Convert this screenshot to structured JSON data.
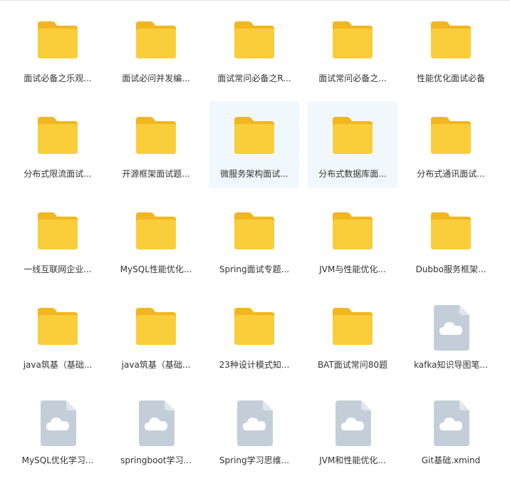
{
  "colors": {
    "folder_back": "#f2b61f",
    "folder_front": "#f9ce3a",
    "file_body": "#c4ced8",
    "file_fold": "#dfe6ec",
    "cloud": "#ffffff",
    "hover_bg": "#f1f8fd"
  },
  "items": [
    {
      "label": "面试必备之乐观...",
      "type": "folder-icon",
      "highlighted": false
    },
    {
      "label": "面试必问并发编...",
      "type": "folder-icon",
      "highlighted": false
    },
    {
      "label": "面试常问必备之R...",
      "type": "folder-icon",
      "highlighted": false
    },
    {
      "label": "面试常问必备之...",
      "type": "folder-icon",
      "highlighted": false
    },
    {
      "label": "性能优化面试必备",
      "type": "folder-icon",
      "highlighted": false
    },
    {
      "label": "分布式限流面试...",
      "type": "folder-icon",
      "highlighted": false
    },
    {
      "label": "开源框架面试题...",
      "type": "folder-icon",
      "highlighted": false
    },
    {
      "label": "微服务架构面试...",
      "type": "folder-icon",
      "highlighted": true
    },
    {
      "label": "分布式数据库面...",
      "type": "folder-icon",
      "highlighted": true
    },
    {
      "label": "分布式通讯面试...",
      "type": "folder-icon",
      "highlighted": false
    },
    {
      "label": "一线互联网企业...",
      "type": "folder-icon",
      "highlighted": false
    },
    {
      "label": "MySQL性能优化...",
      "type": "folder-icon",
      "highlighted": false
    },
    {
      "label": "Spring面试专题...",
      "type": "folder-icon",
      "highlighted": false
    },
    {
      "label": "JVM与性能优化...",
      "type": "folder-icon",
      "highlighted": false
    },
    {
      "label": "Dubbo服务框架...",
      "type": "folder-icon",
      "highlighted": false
    },
    {
      "label": "java筑基（基础...",
      "type": "folder-icon",
      "highlighted": false
    },
    {
      "label": "java筑基（基础...",
      "type": "folder-icon",
      "highlighted": false
    },
    {
      "label": "23种设计模式知...",
      "type": "folder-icon",
      "highlighted": false
    },
    {
      "label": "BAT面试常问80题",
      "type": "folder-icon",
      "highlighted": false
    },
    {
      "label": "kafka知识导图笔...",
      "type": "cloud-file-icon",
      "highlighted": false
    },
    {
      "label": "MySQL优化学习...",
      "type": "cloud-file-icon",
      "highlighted": false
    },
    {
      "label": "springboot学习...",
      "type": "cloud-file-icon",
      "highlighted": false
    },
    {
      "label": "Spring学习思维...",
      "type": "cloud-file-icon",
      "highlighted": false
    },
    {
      "label": "JVM和性能优化...",
      "type": "cloud-file-icon",
      "highlighted": false
    },
    {
      "label": "Git基础.xmind",
      "type": "cloud-file-icon",
      "highlighted": false
    }
  ]
}
